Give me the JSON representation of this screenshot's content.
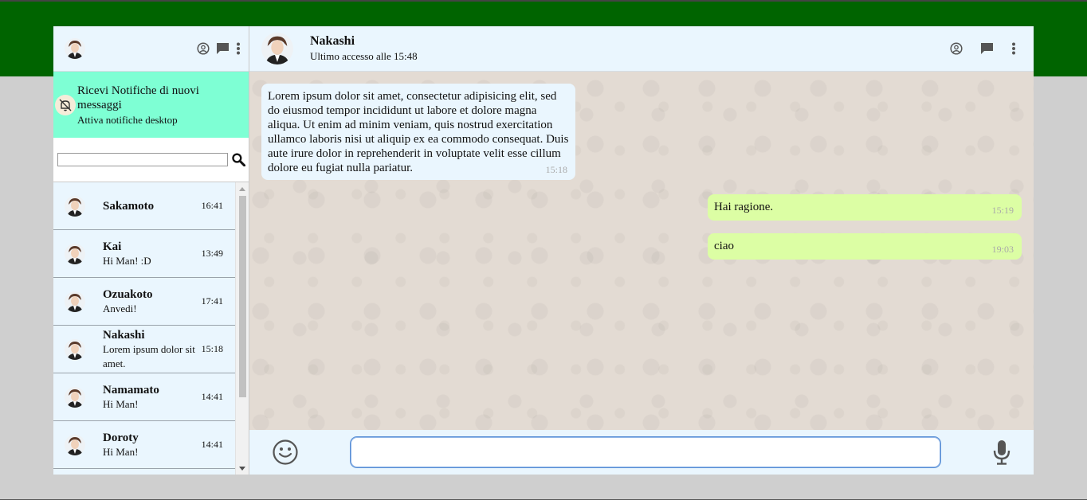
{
  "sidebar": {
    "icons": [
      "user-circle-icon",
      "chat-bubble-icon",
      "kebab-menu-icon"
    ],
    "notice": {
      "title": "Ricevi Notifiche di nuovi messaggi",
      "subtitle": "Attiva notifiche desktop",
      "icon": "bell-off-icon"
    },
    "search": {
      "value": "",
      "placeholder": "",
      "icon": "search-icon"
    },
    "chats": [
      {
        "name": "Sakamoto",
        "last": "",
        "time": "16:41"
      },
      {
        "name": "Kai",
        "last": "Hi Man! :D",
        "time": "13:49"
      },
      {
        "name": "Ozuakoto",
        "last": "Anvedi!",
        "time": "17:41"
      },
      {
        "name": "Nakashi",
        "last": "Lorem ipsum dolor sit amet.",
        "time": "15:18"
      },
      {
        "name": "Namamato",
        "last": "Hi Man!",
        "time": "14:41"
      },
      {
        "name": "Doroty",
        "last": "Hi Man!",
        "time": "14:41"
      }
    ]
  },
  "conversation": {
    "name": "Nakashi",
    "status": "Ultimo accesso alle 15:48",
    "messages": [
      {
        "type": "received",
        "text": "Lorem ipsum dolor sit amet, consectetur adipisicing elit, sed do eiusmod tempor incididunt ut labore et dolore magna aliqua. Ut enim ad minim veniam, quis nostrud exercitation ullamco laboris nisi ut aliquip ex ea commodo consequat. Duis aute irure dolor in reprehenderit in voluptate velit esse cillum dolore eu fugiat nulla pariatur.",
        "time": "15:18"
      },
      {
        "type": "sent",
        "text": "Hai ragione.",
        "time": "15:19"
      },
      {
        "type": "sent",
        "text": "ciao",
        "time": "19:03"
      }
    ]
  },
  "composer": {
    "value": "",
    "placeholder": "",
    "emoji_icon": "smiley-icon",
    "mic_icon": "microphone-icon"
  },
  "colors": {
    "top_band": "#006400",
    "notice_bg": "#7effd4",
    "panel_bg": "#eaf6fe",
    "sent_bubble": "#dcfea4",
    "chat_bg": "#e3dbd3"
  }
}
